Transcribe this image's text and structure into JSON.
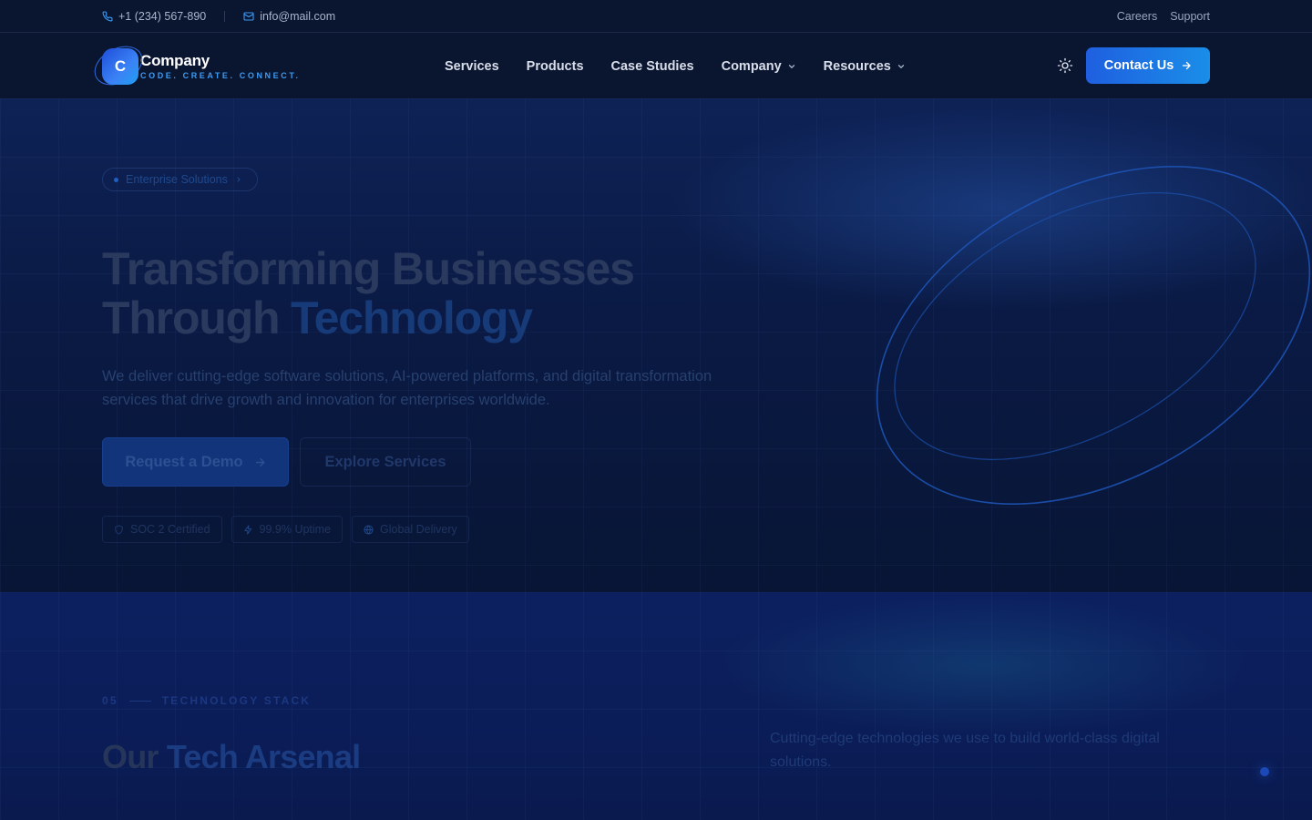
{
  "topbar": {
    "phone": "+1 (234) 567-890",
    "email": "info@mail.com",
    "links": [
      "Careers",
      "Support"
    ]
  },
  "header": {
    "logo_letter": "C",
    "logo_name": "Company",
    "logo_tagline": "CODE. CREATE. CONNECT.",
    "nav": [
      {
        "label": "Services",
        "dropdown": false
      },
      {
        "label": "Products",
        "dropdown": false
      },
      {
        "label": "Case Studies",
        "dropdown": false
      },
      {
        "label": "Company",
        "dropdown": true
      },
      {
        "label": "Resources",
        "dropdown": true
      }
    ],
    "theme_icon": "sun-icon",
    "cta_label": "Contact Us"
  },
  "hero": {
    "badge": "Enterprise Solutions",
    "title_line1": "Transforming Businesses",
    "title_line2_a": "Through ",
    "title_line2_b": "Technology",
    "subtitle": "We deliver cutting-edge software solutions, AI-powered platforms, and digital transformation services that drive growth and innovation for enterprises worldwide.",
    "primary_button": "Request a Demo",
    "secondary_button": "Explore Services",
    "chips": [
      {
        "icon": "shield-icon",
        "label": "SOC 2 Certified"
      },
      {
        "icon": "bolt-icon",
        "label": "99.9% Uptime"
      },
      {
        "icon": "globe-icon",
        "label": "Global Delivery"
      }
    ]
  },
  "tech": {
    "number": "05",
    "label": "TECHNOLOGY STACK",
    "title_a": "Our ",
    "title_b": "Tech Arsenal",
    "subtitle": "Cutting-edge technologies we use to build world-class digital solutions."
  },
  "colors": {
    "background": "#0a1530",
    "accent": "#1f5fe0",
    "accent_light": "#1a8ee8",
    "tagline": "#3b9cf5"
  }
}
